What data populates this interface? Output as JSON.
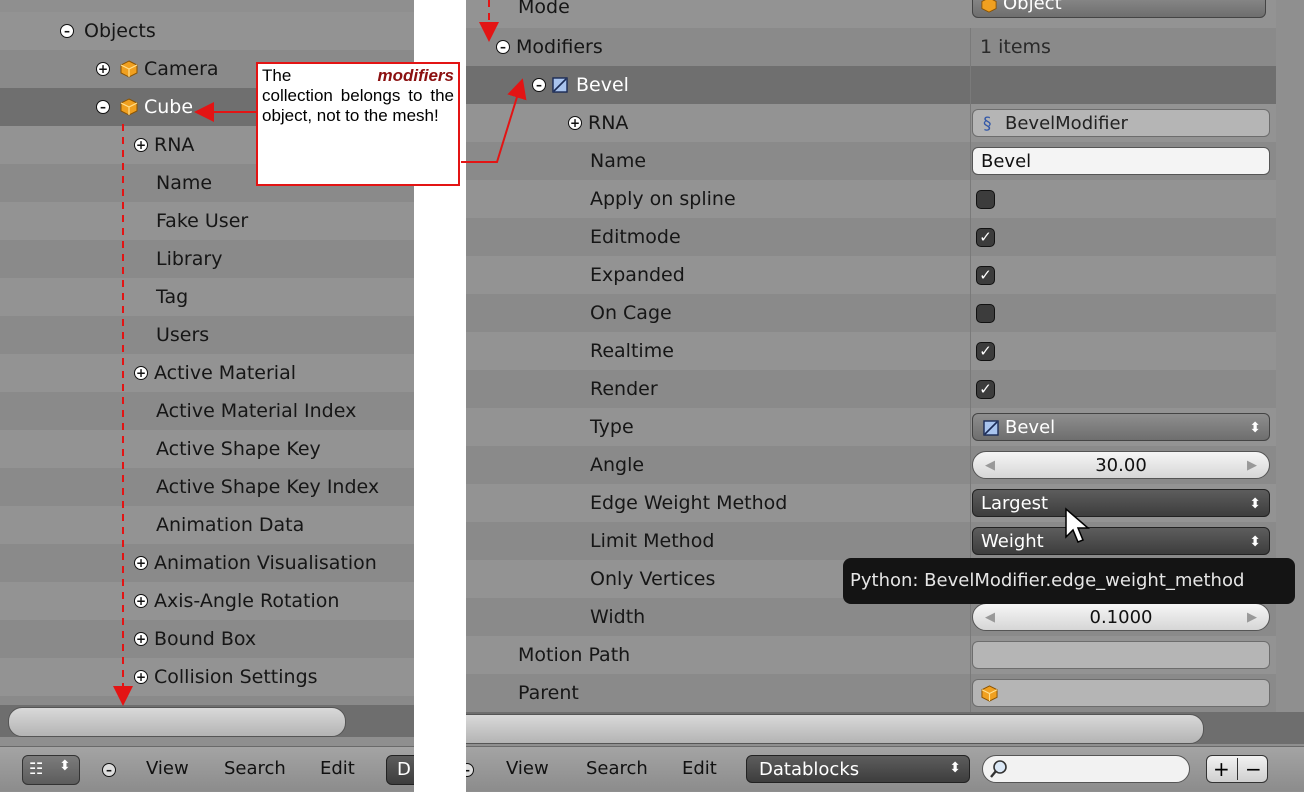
{
  "left": {
    "objects_label": "Objects",
    "camera_label": "Camera",
    "cube_label": "Cube",
    "props": [
      "RNA",
      "Name",
      "Fake User",
      "Library",
      "Tag",
      "Users",
      "Active Material",
      "Active Material Index",
      "Active Shape Key",
      "Active Shape Key Index",
      "Animation Data",
      "Animation Visualisation",
      "Axis-Angle Rotation",
      "Bound Box",
      "Collision Settings"
    ],
    "footer": {
      "view": "View",
      "search": "Search",
      "edit": "Edit",
      "datablocks_partial": "D"
    }
  },
  "right": {
    "mode_label": "Mode",
    "mode_value": "Object",
    "modifiers_label": "Modifiers",
    "modifiers_count": "1 items",
    "bevel_label": "Bevel",
    "rows": [
      {
        "label": "RNA",
        "value": "BevelModifier"
      },
      {
        "label": "Name",
        "value": "Bevel"
      },
      {
        "label": "Apply on spline",
        "checked": false
      },
      {
        "label": "Editmode",
        "checked": true
      },
      {
        "label": "Expanded",
        "checked": true
      },
      {
        "label": "On Cage",
        "checked": false
      },
      {
        "label": "Realtime",
        "checked": true
      },
      {
        "label": "Render",
        "checked": true
      },
      {
        "label": "Type",
        "value": "Bevel"
      },
      {
        "label": "Angle",
        "value": "30.00"
      },
      {
        "label": "Edge Weight Method",
        "value": "Largest"
      },
      {
        "label": "Limit Method",
        "value": "Weight"
      },
      {
        "label": "Only Vertices",
        "value": ""
      },
      {
        "label": "Width",
        "value": "0.1000"
      }
    ],
    "motion_path_label": "Motion Path",
    "parent_label": "Parent",
    "footer": {
      "view": "View",
      "search": "Search",
      "edit": "Edit",
      "datablocks": "Datablocks"
    }
  },
  "callout": {
    "pre": "The",
    "em": "modifiers",
    "post": "collection belongs to the object, not to the mesh!"
  },
  "tooltip": "Python: BevelModifier.edge_weight_method",
  "colors": {
    "annotation_red": "#e31414",
    "panel_bg": "#8f8f8f",
    "selected_row": "#6f6f6f",
    "tooltip_bg": "#141414"
  }
}
